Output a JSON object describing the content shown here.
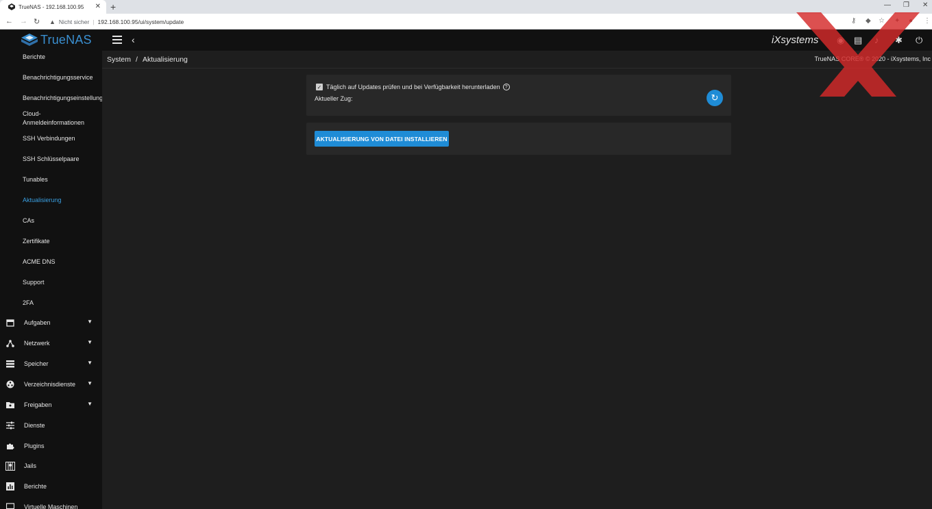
{
  "browser": {
    "tab_title": "TrueNAS - 192.168.100.95",
    "tab_close": "✕",
    "new_tab": "+",
    "security_label": "Nicht sicher",
    "url": "192.168.100.95/ui/system/update"
  },
  "topbar": {
    "brand": "TrueNAS",
    "vendor_logo": "iXsystems"
  },
  "breadcrumb": {
    "parent": "System",
    "separator": "/",
    "current": "Aktualisierung"
  },
  "copyright": "TrueNAS CORE® © 2020 - iXsystems, Inc",
  "sidebar": {
    "sub_items": [
      {
        "label": "Berichte"
      },
      {
        "label": "Benachrichtigungsservice"
      },
      {
        "label": "Benachrichtigungseinstellung"
      },
      {
        "label": "Cloud-Anmeldeinformationen"
      },
      {
        "label": "SSH Verbindungen"
      },
      {
        "label": "SSH Schlüsselpaare"
      },
      {
        "label": "Tunables"
      },
      {
        "label": "Aktualisierung",
        "active": true
      },
      {
        "label": "CAs"
      },
      {
        "label": "Zertifikate"
      },
      {
        "label": "ACME DNS"
      },
      {
        "label": "Support"
      },
      {
        "label": "2FA"
      }
    ],
    "main_items": [
      {
        "label": "Aufgaben",
        "icon": "calendar-icon",
        "expandable": true
      },
      {
        "label": "Netzwerk",
        "icon": "network-icon",
        "expandable": true
      },
      {
        "label": "Speicher",
        "icon": "storage-icon",
        "expandable": true
      },
      {
        "label": "Verzeichnisdienste",
        "icon": "directory-icon",
        "expandable": true
      },
      {
        "label": "Freigaben",
        "icon": "shares-icon",
        "expandable": true
      },
      {
        "label": "Dienste",
        "icon": "sliders-icon",
        "expandable": false
      },
      {
        "label": "Plugins",
        "icon": "puzzle-icon",
        "expandable": false
      },
      {
        "label": "Jails",
        "icon": "jail-icon",
        "expandable": false
      },
      {
        "label": "Berichte",
        "icon": "chart-icon",
        "expandable": false
      },
      {
        "label": "Virtuelle Maschinen",
        "icon": "monitor-icon",
        "expandable": false
      }
    ]
  },
  "update": {
    "auto_check_label": "Täglich auf Updates prüfen und bei Verfügbarkeit herunterladen",
    "auto_check_checked": true,
    "train_label": "Aktueller Zug:",
    "install_button": "AKTUALISIERUNG VON DATEI INSTALLIEREN"
  },
  "colors": {
    "accent": "#1f8cd6",
    "active_link": "#3a9fe0",
    "sidebar_bg": "#111111",
    "content_bg": "#1e1e1e",
    "card_bg": "#282828"
  }
}
